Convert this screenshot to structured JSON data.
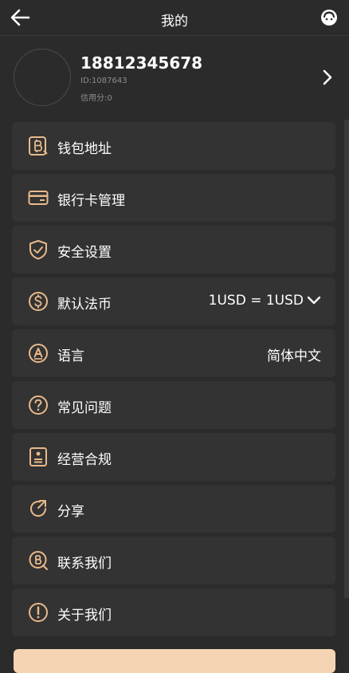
{
  "header": {
    "title": "我的"
  },
  "profile": {
    "phone": "18812345678",
    "id_text": "ID:1087643",
    "credit_text": "信用分:0"
  },
  "menu": [
    {
      "label": "钱包地址",
      "icon": "bitcoin-wallet-icon"
    },
    {
      "label": "银行卡管理",
      "icon": "bank-card-icon"
    },
    {
      "label": "安全设置",
      "icon": "shield-icon"
    },
    {
      "label": "默认法币",
      "icon": "dollar-coin-icon",
      "value": "1USD = 1USD"
    },
    {
      "label": "语言",
      "icon": "language-icon",
      "value": "简体中文"
    },
    {
      "label": "常见问题",
      "icon": "question-icon"
    },
    {
      "label": "经营合规",
      "icon": "compliance-icon"
    },
    {
      "label": "分享",
      "icon": "share-icon"
    },
    {
      "label": "联系我们",
      "icon": "contact-icon"
    },
    {
      "label": "关于我们",
      "icon": "info-icon"
    }
  ],
  "colors": {
    "background": "#2b2b2b",
    "row_background": "#333333",
    "accent": "#e9b98a",
    "text": "#ffffff",
    "muted": "#8d8d8d"
  }
}
